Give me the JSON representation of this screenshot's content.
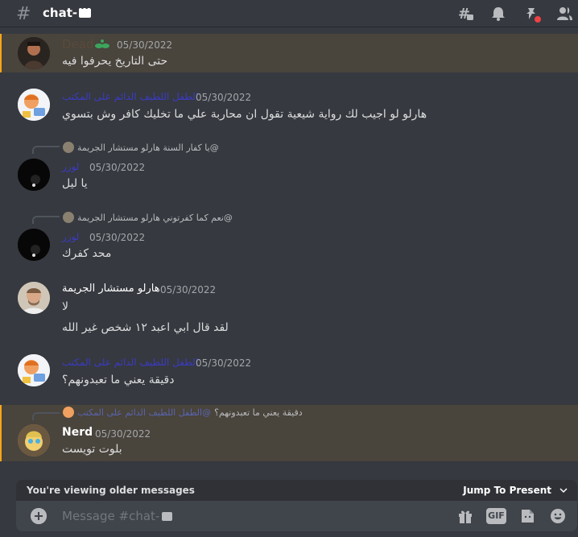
{
  "header": {
    "channel_name": "chat-",
    "icons": [
      "threads-icon",
      "bell-icon",
      "pin-icon",
      "members-icon"
    ]
  },
  "messages": [
    {
      "id": "m1",
      "username": "Dead",
      "username_color": "#5a4a3a",
      "badge": "leaf-icon",
      "timestamp": "05/30/2022",
      "lines": [
        "حتى التاريخ يحرفوا فيه"
      ],
      "highlighted": true
    },
    {
      "id": "m2",
      "username": "الطفل اللطيف الدائم على المكتب",
      "username_color": "#3b3bc4",
      "timestamp": "05/30/2022",
      "lines": [
        "هارلو لو اجيب لك رواية شيعية تقول ان محاربة علي ما تخليك كافر وش بتسوي"
      ]
    },
    {
      "id": "m3",
      "reply_to": {
        "mention": "يا كفار السنة هارلو مستشار الجريمة@"
      },
      "username": "لوزر",
      "username_color": "#3b3bc4",
      "timestamp": "05/30/2022",
      "lines": [
        "يا ليل"
      ]
    },
    {
      "id": "m4",
      "reply_to": {
        "mention": "نعم كما كفرتوني هارلو مستشار الجريمة@"
      },
      "username": "لوزر",
      "username_color": "#3b3bc4",
      "timestamp": "05/30/2022",
      "lines": [
        "محد كفرك"
      ]
    },
    {
      "id": "m5",
      "username": "هارلو مستشار الجريمة",
      "username_color": "#ffffff",
      "timestamp": "05/30/2022",
      "lines": [
        "لا",
        "لقد قال ابي اعبد ١٢ شخص غير الله"
      ]
    },
    {
      "id": "m6",
      "username": "الطفل اللطيف الدائم على المكتب",
      "username_color": "#3b3bc4",
      "timestamp": "05/30/2022",
      "lines": [
        "دقيقة يعني ما تعبدونهم؟"
      ]
    },
    {
      "id": "m7",
      "reply_to": {
        "name": "الطفل اللطيف الدائم على المكتب@",
        "text": "دقيقة يعني ما تعبدونهم؟"
      },
      "username": "Nerd",
      "username_color": "#ffffff",
      "timestamp": "05/30/2022",
      "lines": [
        "بلوت تويست"
      ],
      "highlighted": true
    }
  ],
  "older_notice": {
    "label": "You're viewing older messages",
    "jump": "Jump To Present"
  },
  "composer": {
    "placeholder": "Message #chat-",
    "icons": [
      "gift-icon",
      "gif-icon",
      "sticker-icon",
      "emoji-icon"
    ],
    "gif_label": "GIF"
  }
}
